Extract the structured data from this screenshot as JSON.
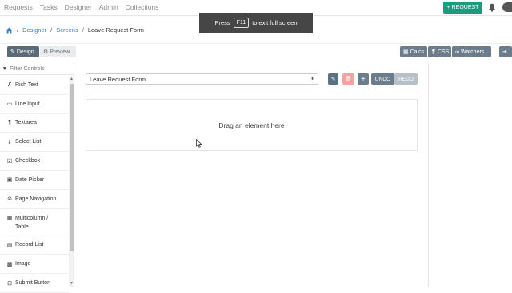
{
  "nav": {
    "links": [
      "Requests",
      "Tasks",
      "Designer",
      "Admin",
      "Collections"
    ],
    "request_button": "REQUEST"
  },
  "toast": {
    "prefix": "Press",
    "key": "F11",
    "suffix": "to exit full screen"
  },
  "breadcrumb": {
    "items": [
      "Designer",
      "Screens"
    ],
    "current": "Leave Request Form"
  },
  "toolbar": {
    "design": "Design",
    "preview": "Preview",
    "calcs": "Calcs",
    "css": "CSS",
    "watchers": "Watchers"
  },
  "sidebar": {
    "filter_placeholder": "Filter Controls",
    "controls": [
      {
        "icon": "rich-text-icon",
        "label": "Rich Text"
      },
      {
        "icon": "line-input-icon",
        "label": "Line Input"
      },
      {
        "icon": "textarea-icon",
        "label": "Textarea"
      },
      {
        "icon": "select-list-icon",
        "label": "Select List"
      },
      {
        "icon": "checkbox-icon",
        "label": "Checkbox"
      },
      {
        "icon": "date-picker-icon",
        "label": "Date Picker"
      },
      {
        "icon": "page-navigation-icon",
        "label": "Page Navigation"
      },
      {
        "icon": "multicolumn-icon",
        "label": "Multicolumn / Table"
      },
      {
        "icon": "record-list-icon",
        "label": "Record List"
      },
      {
        "icon": "image-icon",
        "label": "Image"
      },
      {
        "icon": "submit-button-icon",
        "label": "Submit Button"
      }
    ]
  },
  "canvas": {
    "form_select": "Leave Request Form",
    "undo": "UNDO",
    "redo": "REDO",
    "dropzone": "Drag an element here"
  },
  "colors": {
    "primary": "#1a9c7d",
    "toolbar_button": "#6b7d8c",
    "edit": "#5b7285",
    "delete": "#f3a3a0",
    "add": "#6b7d8c",
    "undo": "#6b7d8c",
    "redo": "#b7c0c8"
  }
}
